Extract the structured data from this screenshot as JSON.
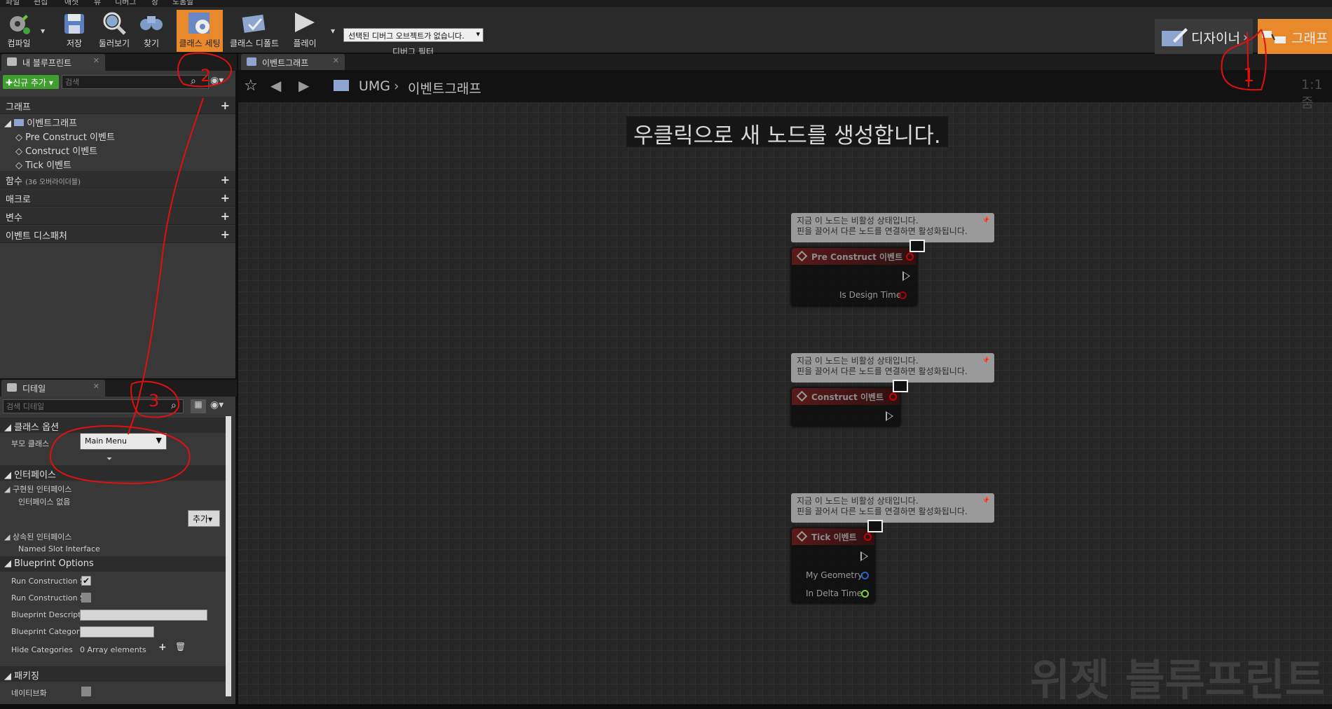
{
  "menu": [
    "파일",
    "편집",
    "애셋",
    "뷰",
    "디버그",
    "창",
    "도움말"
  ],
  "toolbar": {
    "compile": "컴파일",
    "save": "저장",
    "browse": "둘러보기",
    "find": "찾기",
    "class_settings": "클래스 세팅",
    "class_defaults": "클래스 디폴트",
    "play": "플레이",
    "debug_select": "선택된 디버그 오브젝트가 없습니다.",
    "debug_filter": "디버그 필터"
  },
  "modes": {
    "designer": "디자이너",
    "graph": "그래프"
  },
  "my_blueprint": {
    "tab": "내 블루프린트",
    "add_new": "신규 추가",
    "search_placeholder": "검색",
    "graphs": "그래프",
    "event_graph": "이벤트그래프",
    "events": [
      "Pre Construct 이벤트",
      "Construct 이벤트",
      "Tick 이벤트"
    ],
    "functions": "함수",
    "functions_override": "(36 오버라이더블)",
    "macros": "매크로",
    "variables": "변수",
    "event_dispatchers": "이벤트 디스패처"
  },
  "details": {
    "tab": "디테일",
    "search_placeholder": "검색 디테일",
    "class_options": "클래스 옵션",
    "parent_class_label": "부모 클래스",
    "parent_class_value": "Main Menu",
    "interfaces": "인터페이스",
    "implemented": "구현된 인터페이스",
    "no_interfaces": "인터페이스 없음",
    "add": "추가",
    "inherited": "상속된 인터페이스",
    "named_slot": "Named Slot Interface",
    "bp_options": "Blueprint Options",
    "run_cs1": "Run Construction S",
    "run_cs2": "Run Construction S",
    "bp_description": "Blueprint Descriptio",
    "bp_category": "Blueprint Category",
    "hide_categories": "Hide Categories",
    "array_elements": "0 Array elements",
    "packaging": "패키징",
    "nativize": "네이티브화"
  },
  "graph": {
    "tab": "이벤트그래프",
    "breadcrumb_root": "UMG",
    "breadcrumb_current": "이벤트그래프",
    "zoom": "1:1 줌",
    "hint": "우클릭으로 새 노드를 생성합니다.",
    "watermark": "위젯 블루프린트",
    "comment_line1": "지금 이 노드는 비활성 상태입니다.",
    "comment_line2": "핀을 끌어서 다른 노드를 연결하면 활성화됩니다.",
    "nodes": [
      {
        "title": "Pre Construct 이벤트",
        "pins": [
          "Is Design Time"
        ]
      },
      {
        "title": "Construct 이벤트",
        "pins": []
      },
      {
        "title": "Tick 이벤트",
        "pins": [
          "My Geometry",
          "In Delta Time"
        ]
      }
    ]
  },
  "annotations": [
    "1",
    "2",
    "3"
  ],
  "colors": {
    "accent": "#e8892c",
    "node_header": "#5a1a1a",
    "graph_bg": "#262626"
  }
}
